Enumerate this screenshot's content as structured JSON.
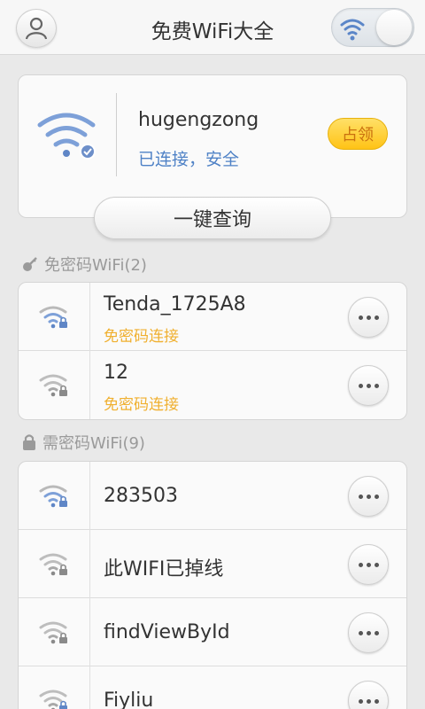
{
  "header": {
    "title": "免费WiFi大全",
    "user_icon": "user-icon",
    "toggle_icon": "wifi-icon",
    "toggle_on": true
  },
  "connected": {
    "ssid": "hugengzong",
    "status": "已连接，安全",
    "claim_label": "占领",
    "query_label": "一键查询",
    "icon": "wifi-connected-icon"
  },
  "free_section": {
    "title": "免密码WiFi(2)",
    "icon": "key-icon",
    "items": [
      {
        "name": "Tenda_1725A8",
        "sub": "免密码连接"
      },
      {
        "name": "12",
        "sub": "免密码连接"
      }
    ]
  },
  "locked_section": {
    "title": "需密码WiFi(9)",
    "icon": "lock-icon",
    "items": [
      {
        "name": "283503"
      },
      {
        "name": "此WIFI已掉线"
      },
      {
        "name": "findViewById"
      },
      {
        "name": "Fiyliu"
      }
    ]
  },
  "colors": {
    "accent_blue": "#4f82c6",
    "claim_yellow": "#ffc316",
    "free_text": "#f0b030"
  }
}
